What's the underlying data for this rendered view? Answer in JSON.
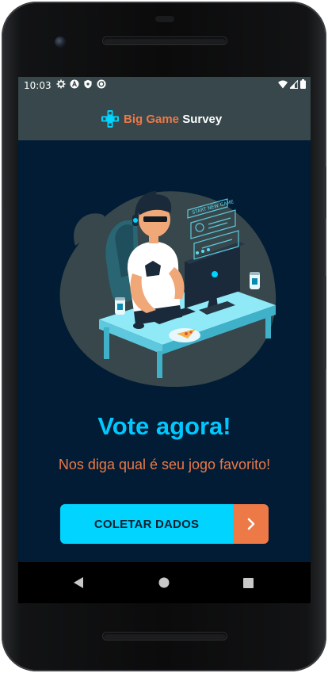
{
  "status_bar": {
    "time": "10:03",
    "left_icons": [
      "settings-icon",
      "a-badge-icon",
      "shield-icon",
      "sync-icon"
    ],
    "right_icons": [
      "wifi-icon",
      "signal-icon",
      "battery-icon"
    ]
  },
  "app_bar": {
    "brand_part1": "Big Game",
    "brand_part2": "Survey",
    "logo_icon": "gamepad-cross-icon"
  },
  "hero": {
    "illustration": "gamer-at-desk-illustration",
    "screen_banner_text": "START NEW GAME"
  },
  "main": {
    "headline": "Vote agora!",
    "subtitle": "Nos diga qual é seu jogo favorito!",
    "cta_label": "COLETAR DADOS",
    "cta_icon": "chevron-right-icon"
  },
  "nav_bar": {
    "buttons": [
      "back-icon",
      "home-icon",
      "recents-icon"
    ]
  },
  "colors": {
    "accent_cyan": "#00c8ff",
    "accent_orange": "#ed7947",
    "background": "#011c34",
    "app_bar": "#37474b"
  }
}
